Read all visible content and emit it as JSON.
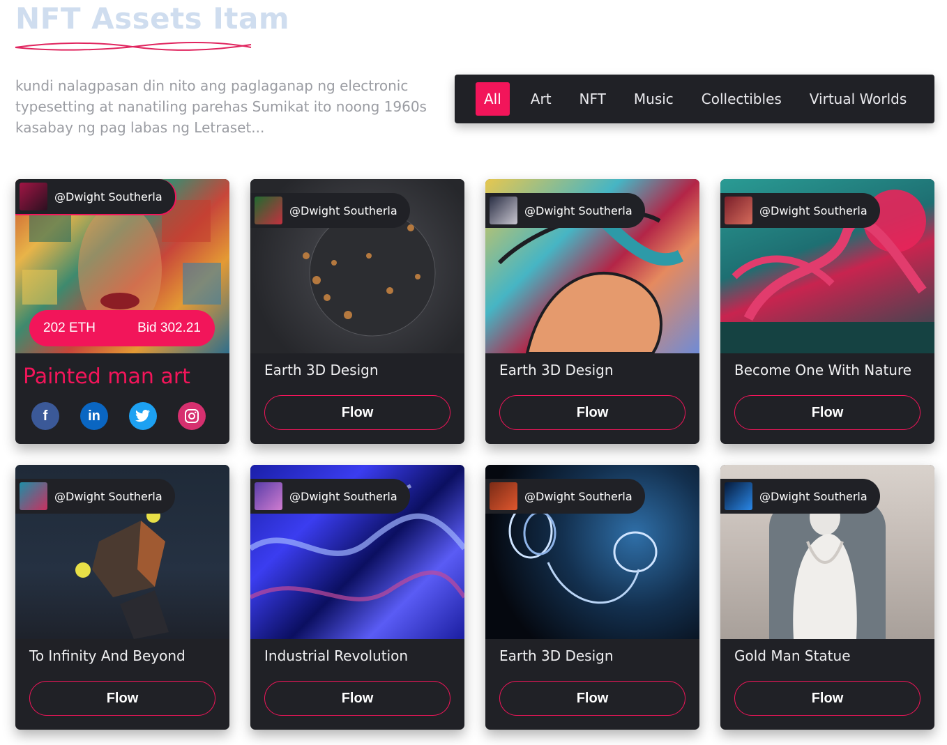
{
  "header": {
    "title": "NFT Assets Itam",
    "description": "kundi nalagpasan din nito ang paglaganap ng electronic typesetting at nanatiling parehas Sumikat ito noong 1960s kasabay ng pag labas ng Letraset..."
  },
  "filters": [
    "All",
    "Art",
    "NFT",
    "Music",
    "Collectibles",
    "Virtual Worlds"
  ],
  "colors": {
    "accent": "#f2155a",
    "card": "#202126",
    "title": "#cfddef"
  },
  "featured": {
    "author": "@Dwight Southerla",
    "price": "202 ETH",
    "bid": "Bid 302.21",
    "name": "Painted man art",
    "socials": [
      "facebook-icon",
      "linkedin-icon",
      "twitter-icon",
      "instagram-icon"
    ]
  },
  "cards": [
    {
      "author": "@Dwight Southerla",
      "name": "Earth 3D Design",
      "button": "Flow"
    },
    {
      "author": "@Dwight Southerla",
      "name": "Earth 3D Design",
      "button": "Flow"
    },
    {
      "author": "@Dwight Southerla",
      "name": "Become One With Nature",
      "button": "Flow"
    },
    {
      "author": "@Dwight Southerla",
      "name": "To Infinity And Beyond",
      "button": "Flow"
    },
    {
      "author": "@Dwight Southerla",
      "name": "Industrial Revolution",
      "button": "Flow"
    },
    {
      "author": "@Dwight Southerla",
      "name": "Earth 3D Design",
      "button": "Flow"
    },
    {
      "author": "@Dwight Southerla",
      "name": "Gold Man Statue",
      "button": "Flow"
    }
  ]
}
